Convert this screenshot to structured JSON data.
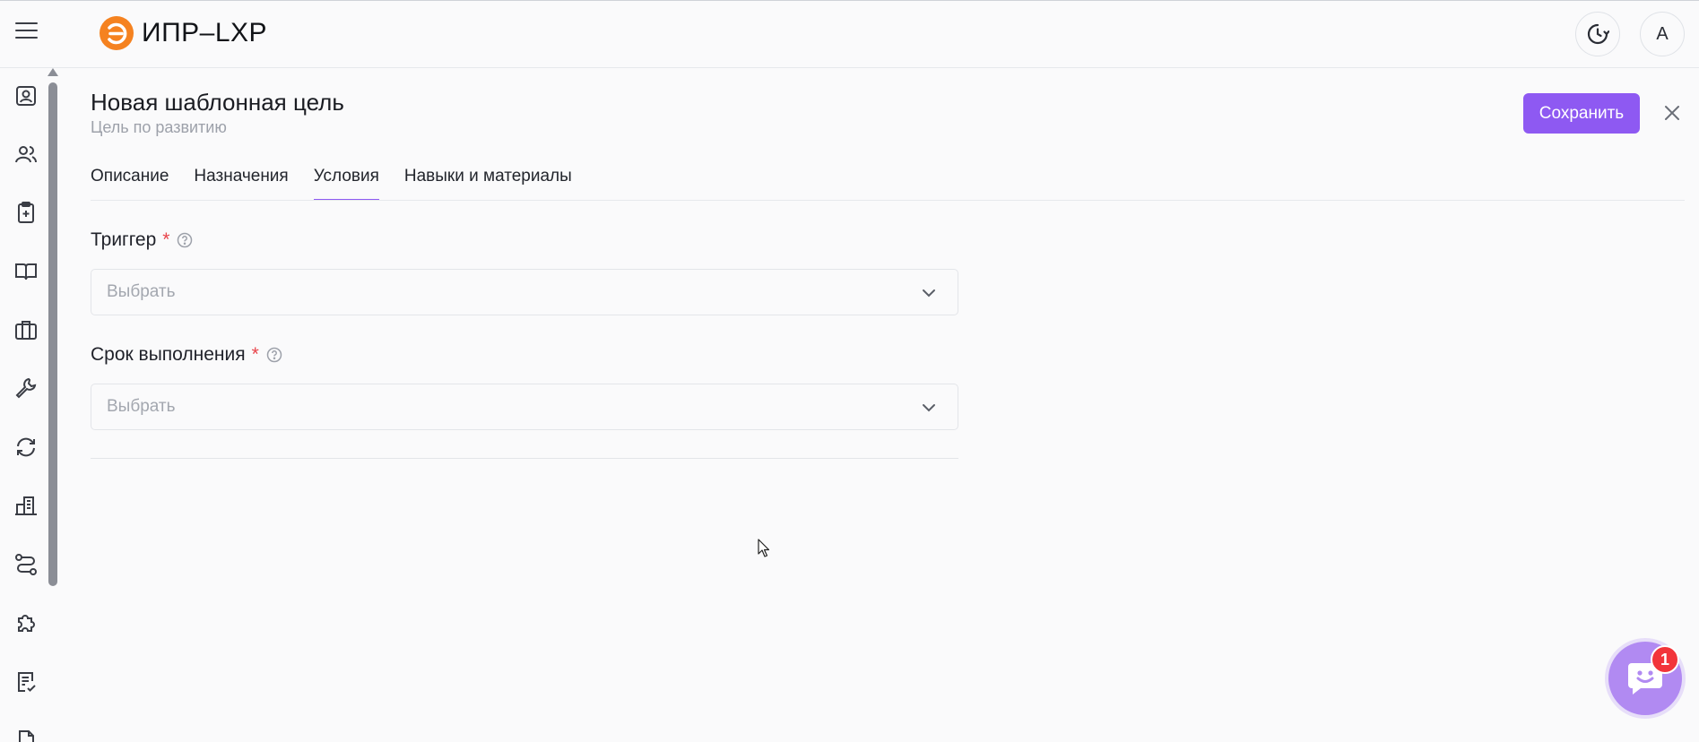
{
  "app": {
    "logo_text": "ИПР–LXP",
    "brand_color": "#f58220",
    "accent_color": "#8e59f2",
    "avatar_letter": "А"
  },
  "header": {
    "icons": [
      "menu-icon",
      "history-icon"
    ]
  },
  "sidebar": {
    "items": [
      {
        "name": "profile-icon"
      },
      {
        "name": "users-icon"
      },
      {
        "name": "clipboard-plus-icon"
      },
      {
        "name": "book-icon"
      },
      {
        "name": "briefcase-icon"
      },
      {
        "name": "wrench-icon"
      },
      {
        "name": "refresh-icon"
      },
      {
        "name": "building-icon"
      },
      {
        "name": "route-icon"
      },
      {
        "name": "puzzle-icon"
      },
      {
        "name": "checklist-icon"
      },
      {
        "name": "document-icon"
      }
    ]
  },
  "page": {
    "title": "Новая шаблонная цель",
    "subtitle": "Цель по развитию",
    "save_label": "Сохранить"
  },
  "tabs": [
    {
      "label": "Описание",
      "active": false
    },
    {
      "label": "Назначения",
      "active": false
    },
    {
      "label": "Условия",
      "active": true
    },
    {
      "label": "Навыки и материалы",
      "active": false
    }
  ],
  "form": {
    "trigger": {
      "label": "Триггер",
      "required_mark": "*",
      "placeholder": "Выбрать"
    },
    "deadline": {
      "label": "Срок выполнения",
      "required_mark": "*",
      "placeholder": "Выбрать"
    }
  },
  "chat": {
    "badge_count": "1"
  }
}
